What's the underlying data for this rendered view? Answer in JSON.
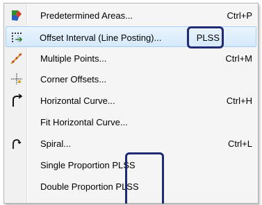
{
  "menu": {
    "items": [
      {
        "label": "Predetermined Areas...",
        "shortcut": "Ctrl+P",
        "icon": "predetermined-areas-icon"
      },
      {
        "label": "Offset Interval (Line Posting)...",
        "shortcut": "PLSS",
        "icon": "offset-interval-icon",
        "highlighted": true
      },
      {
        "label": "Multiple Points...",
        "shortcut": "Ctrl+M",
        "icon": "multiple-points-icon"
      },
      {
        "label": "Corner Offsets...",
        "shortcut": "",
        "icon": "corner-offsets-icon"
      },
      {
        "label": "Horizontal Curve...",
        "shortcut": "Ctrl+H",
        "icon": "horizontal-curve-icon"
      },
      {
        "label": "Fit Horizontal Curve...",
        "shortcut": "",
        "icon": ""
      },
      {
        "label": "Spiral...",
        "shortcut": "Ctrl+L",
        "icon": "spiral-icon"
      },
      {
        "label": "Single Proportion PLSS",
        "shortcut": "",
        "icon": ""
      },
      {
        "label": "Double Proportion PLSS",
        "shortcut": "",
        "icon": ""
      }
    ]
  },
  "colors": {
    "callout": "#1f2a72",
    "highlight": "#d5e9fb"
  }
}
